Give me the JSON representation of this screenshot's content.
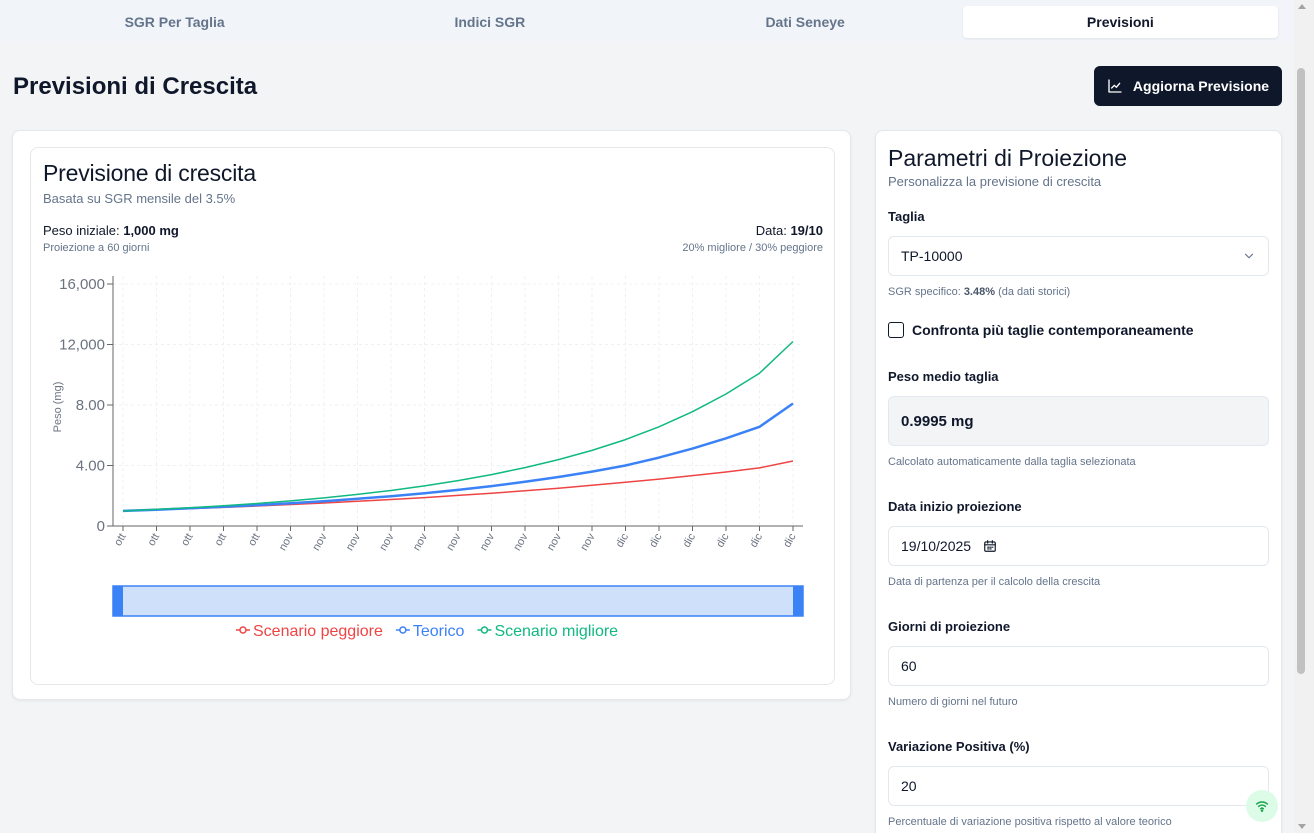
{
  "tabs": [
    {
      "label": "SGR Per Taglia",
      "active": false
    },
    {
      "label": "Indici SGR",
      "active": false
    },
    {
      "label": "Dati Seneye",
      "active": false
    },
    {
      "label": "Previsioni",
      "active": true
    }
  ],
  "page_title": "Previsioni di Crescita",
  "refresh_button": {
    "label": "Aggiorna Previsione",
    "icon": "line-chart-icon"
  },
  "chart_card": {
    "title": "Previsione di crescita",
    "subtitle": "Basata su SGR mensile del 3.5%",
    "peso_label": "Peso iniziale: ",
    "peso_value": "1,000 mg",
    "projection_text": "Proiezione a 60 giorni",
    "data_label": "Data: ",
    "data_value": "19/10",
    "variation_text": "20% migliore / 30% peggiore"
  },
  "chart_data": {
    "type": "line",
    "title": "",
    "xlabel": "",
    "ylabel": "Peso (mg)",
    "ylim": [
      0,
      16000
    ],
    "y_ticks": [
      {
        "value": 0,
        "label": "0"
      },
      {
        "value": 4000,
        "label": "4.00"
      },
      {
        "value": 8000,
        "label": "8.00"
      },
      {
        "value": 12000,
        "label": "12,000"
      },
      {
        "value": 16000,
        "label": "16,000"
      }
    ],
    "x_tick_labels": [
      "ott",
      "ott",
      "ott",
      "ott",
      "ott",
      "nov",
      "nov",
      "nov",
      "nov",
      "nov",
      "nov",
      "nov",
      "nov",
      "nov",
      "nov",
      "dic",
      "dic",
      "dic",
      "dic",
      "dic",
      "dic"
    ],
    "x": [
      0,
      3,
      6,
      9,
      12,
      15,
      18,
      21,
      24,
      27,
      30,
      33,
      36,
      39,
      42,
      45,
      48,
      51,
      54,
      57,
      60
    ],
    "series": [
      {
        "name": "Scenario peggiore",
        "color": "#ef4444",
        "values": [
          1000,
          1070,
          1150,
          1230,
          1320,
          1420,
          1520,
          1630,
          1750,
          1880,
          2020,
          2170,
          2330,
          2500,
          2690,
          2890,
          3100,
          3330,
          3570,
          3840,
          4300
        ]
      },
      {
        "name": "Teorico",
        "color": "#3b82f6",
        "values": [
          1000,
          1080,
          1170,
          1270,
          1380,
          1500,
          1640,
          1800,
          1970,
          2170,
          2390,
          2640,
          2920,
          3240,
          3600,
          4000,
          4520,
          5120,
          5800,
          6560,
          8100
        ]
      },
      {
        "name": "Scenario migliore",
        "color": "#10b981",
        "values": [
          1000,
          1100,
          1210,
          1340,
          1490,
          1660,
          1860,
          2090,
          2350,
          2650,
          3000,
          3400,
          3860,
          4390,
          5000,
          5710,
          6560,
          7560,
          8730,
          10100,
          12200
        ]
      }
    ],
    "legend_position": "bottom",
    "grid": true
  },
  "params": {
    "title": "Parametri di Proiezione",
    "subtitle": "Personalizza la previsione di crescita",
    "taglia_label": "Taglia",
    "taglia_value": "TP-10000",
    "sgr_prefix": "SGR specifico: ",
    "sgr_value": "3.48%",
    "sgr_suffix": " (da dati storici)",
    "compare_label": "Confronta più taglie contemporaneamente",
    "peso_label": "Peso medio taglia",
    "peso_value": "0.9995 mg",
    "peso_help": "Calcolato automaticamente dalla taglia selezionata",
    "data_label": "Data inizio proiezione",
    "data_value": "19/10/2025",
    "data_help": "Data di partenza per il calcolo della crescita",
    "giorni_label": "Giorni di proiezione",
    "giorni_value": "60",
    "giorni_help": "Numero di giorni nel futuro",
    "var_label": "Variazione Positiva (%)",
    "var_value": "20",
    "var_help": "Percentuale di variazione positiva rispetto al valore teorico"
  }
}
